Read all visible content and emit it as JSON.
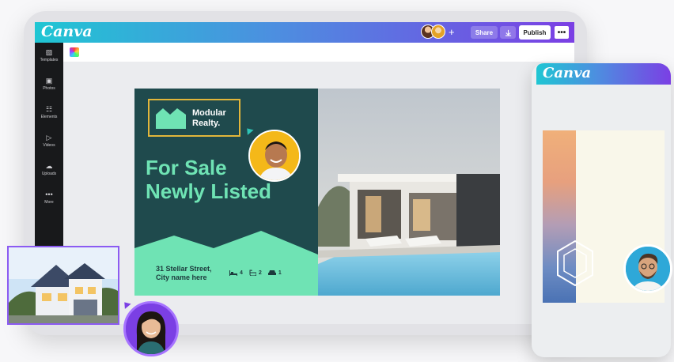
{
  "app": {
    "logo": "Canva",
    "share_label": "Share",
    "publish_label": "Publish",
    "download_icon": "download-icon",
    "more_label": "•••",
    "add_collaborator_label": "+"
  },
  "sidebar": {
    "items": [
      {
        "label": "Templates",
        "icon": "▨"
      },
      {
        "label": "Photos",
        "icon": "▣"
      },
      {
        "label": "Elements",
        "icon": "☷"
      },
      {
        "label": "Videos",
        "icon": "▷"
      },
      {
        "label": "Uploads",
        "icon": "☁"
      },
      {
        "label": "More",
        "icon": "•••"
      }
    ]
  },
  "design": {
    "brand_line1": "Modular",
    "brand_line2": "Realty.",
    "headline_line1": "For Sale",
    "headline_line2": "Newly Listed",
    "address_line1": "31 Stellar Street,",
    "address_line2": "City name here",
    "beds": "4",
    "baths": "2",
    "cars": "1"
  },
  "phone": {
    "logo": "Canva"
  },
  "colors": {
    "brand_gradient_start": "#1fc6d3",
    "brand_gradient_end": "#7b3fe4",
    "design_bg": "#1f4a4d",
    "design_accent": "#6fe3b4",
    "brand_frame": "#e2b63b",
    "selection": "#8c5bf2"
  }
}
